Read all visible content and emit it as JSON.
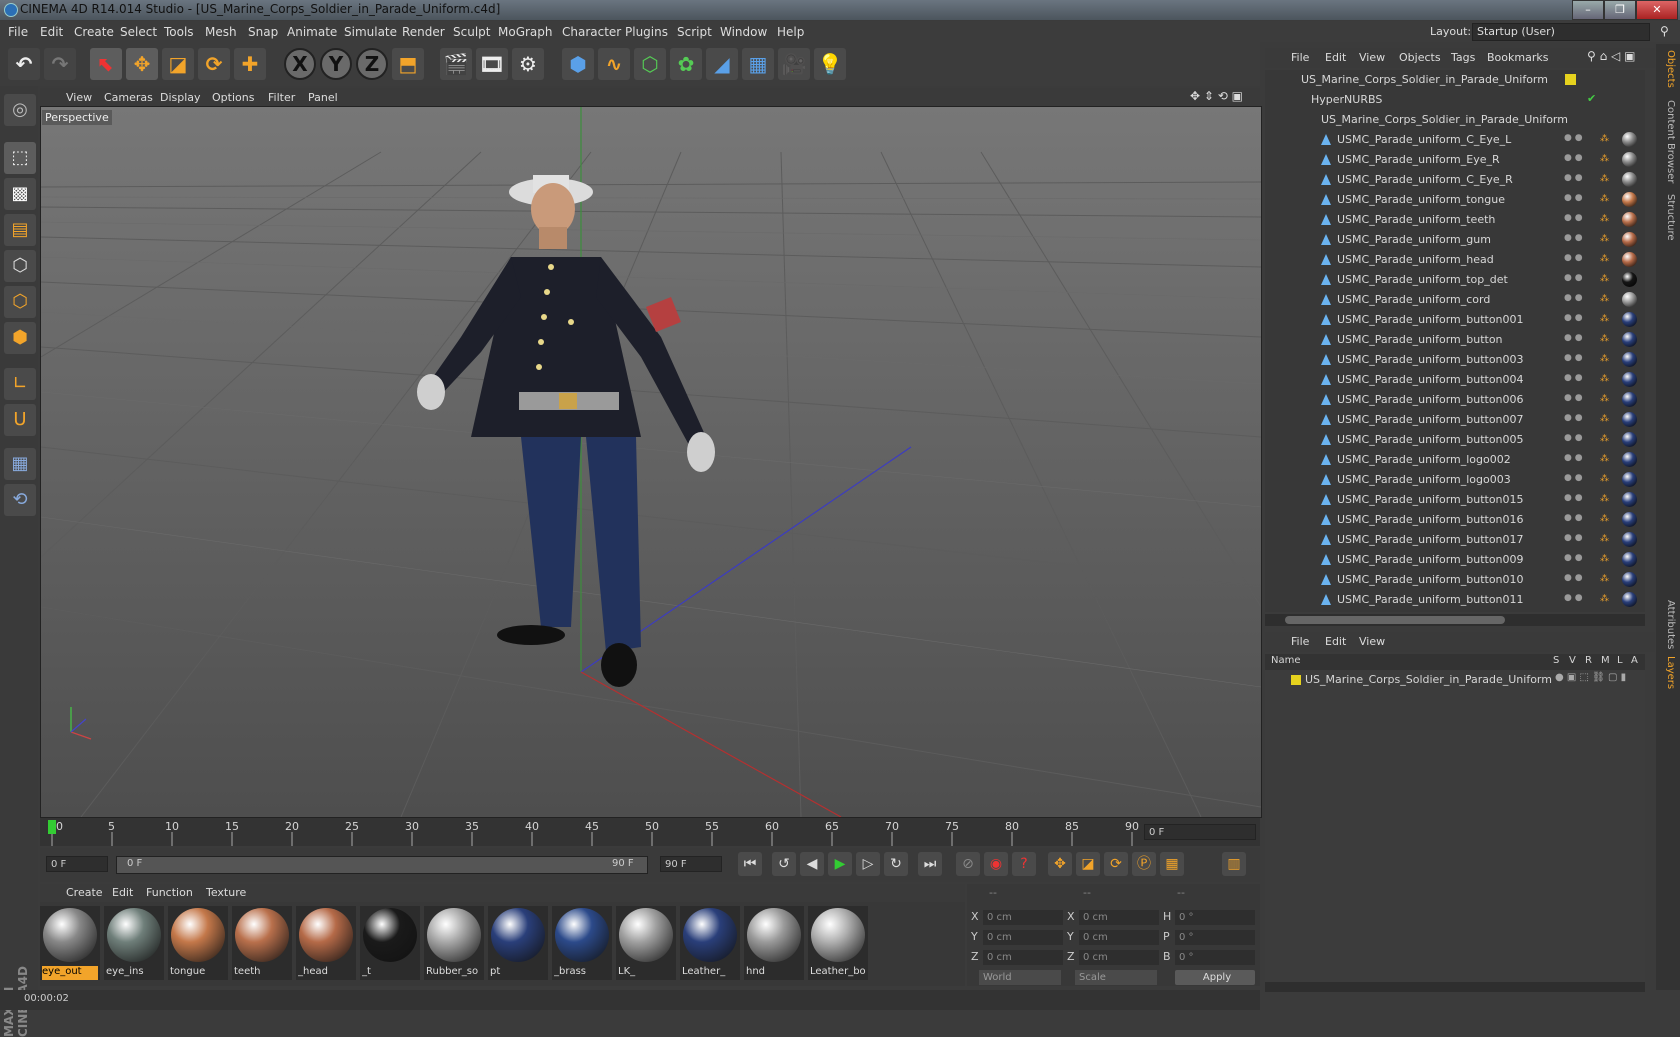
{
  "app": {
    "title": "CINEMA 4D R14.014 Studio - [US_Marine_Corps_Soldier_in_Parade_Uniform.c4d]",
    "layout_label": "Layout:",
    "layout_value": "Startup (User)"
  },
  "menu": [
    "File",
    "Edit",
    "Create",
    "Select",
    "Tools",
    "Mesh",
    "Snap",
    "Animate",
    "Simulate",
    "Render",
    "Sculpt",
    "MoGraph",
    "Character",
    "Plugins",
    "Script",
    "Window",
    "Help"
  ],
  "viewport": {
    "menu": [
      "View",
      "Cameras",
      "Display",
      "Options",
      "Filter",
      "Panel"
    ],
    "label": "Perspective"
  },
  "timeline": {
    "ticks": [
      "0",
      "5",
      "10",
      "15",
      "20",
      "25",
      "30",
      "35",
      "40",
      "45",
      "50",
      "55",
      "60",
      "65",
      "70",
      "75",
      "80",
      "85",
      "90"
    ],
    "current_frame": "0 F",
    "start": "0 F",
    "slider_start": "0 F",
    "slider_end": "90 F",
    "end": "90 F"
  },
  "materials": {
    "menu": [
      "Create",
      "Edit",
      "Function",
      "Texture"
    ],
    "items": [
      {
        "label": "eye_out",
        "color": "#888888",
        "active": true
      },
      {
        "label": "eye_ins",
        "color": "#6f7f7a",
        "active": false
      },
      {
        "label": "tongue",
        "color": "#c4784a",
        "active": false
      },
      {
        "label": "teeth",
        "color": "#b9704c",
        "active": false
      },
      {
        "label": "_head",
        "color": "#b56a48",
        "active": false
      },
      {
        "label": "_t",
        "color": "#1a1a1a",
        "active": false
      },
      {
        "label": "Rubber_so",
        "color": "#a8a8a8",
        "active": false
      },
      {
        "label": "pt",
        "color": "#2a3f7a",
        "active": false
      },
      {
        "label": "_brass",
        "color": "#2c4a8a",
        "active": false
      },
      {
        "label": "LK_",
        "color": "#a0a0a0",
        "active": false
      },
      {
        "label": "Leather_",
        "color": "#2a3f7a",
        "active": false
      },
      {
        "label": "hnd",
        "color": "#9a9a9a",
        "active": false
      },
      {
        "label": "Leather_bo",
        "color": "#b0b0b0",
        "active": false
      }
    ]
  },
  "coords": {
    "headers": [
      "--",
      "--",
      "--"
    ],
    "rows": [
      {
        "a": "X",
        "av": "0 cm",
        "b": "X",
        "bv": "0 cm",
        "c": "H",
        "cv": "0 °"
      },
      {
        "a": "Y",
        "av": "0 cm",
        "b": "Y",
        "bv": "0 cm",
        "c": "P",
        "cv": "0 °"
      },
      {
        "a": "Z",
        "av": "0 cm",
        "b": "Z",
        "bv": "0 cm",
        "c": "B",
        "cv": "0 °"
      }
    ],
    "world": "World",
    "scale": "Scale",
    "apply": "Apply"
  },
  "status": "00:00:02",
  "objects": {
    "menu": [
      "File",
      "Edit",
      "View",
      "Objects",
      "Tags",
      "Bookmarks"
    ],
    "root": "US_Marine_Corps_Soldier_in_Parade_Uniform",
    "hypernurbs": "HyperNURBS",
    "group": "US_Marine_Corps_Soldier_in_Parade_Uniform",
    "children": [
      {
        "name": "USMC_Parade_uniform_C_Eye_L",
        "mat": "#8a8a8a"
      },
      {
        "name": "USMC_Parade_uniform_Eye_R",
        "mat": "#8a8a8a"
      },
      {
        "name": "USMC_Parade_uniform_C_Eye_R",
        "mat": "#8a8a8a"
      },
      {
        "name": "USMC_Parade_uniform_tongue",
        "mat": "#c4784a"
      },
      {
        "name": "USMC_Parade_uniform_teeth",
        "mat": "#b9704c"
      },
      {
        "name": "USMC_Parade_uniform_gum",
        "mat": "#b56a48"
      },
      {
        "name": "USMC_Parade_uniform_head",
        "mat": "#b56a48"
      },
      {
        "name": "USMC_Parade_uniform_top_det",
        "mat": "#151515"
      },
      {
        "name": "USMC_Parade_uniform_cord",
        "mat": "#9a9a9a"
      },
      {
        "name": "USMC_Parade_uniform_button001",
        "mat": "#2a3f7a"
      },
      {
        "name": "USMC_Parade_uniform_button",
        "mat": "#2a3f7a"
      },
      {
        "name": "USMC_Parade_uniform_button003",
        "mat": "#2a3f7a"
      },
      {
        "name": "USMC_Parade_uniform_button004",
        "mat": "#2a3f7a"
      },
      {
        "name": "USMC_Parade_uniform_button006",
        "mat": "#2a3f7a"
      },
      {
        "name": "USMC_Parade_uniform_button007",
        "mat": "#2a3f7a"
      },
      {
        "name": "USMC_Parade_uniform_button005",
        "mat": "#2a3f7a"
      },
      {
        "name": "USMC_Parade_uniform_logo002",
        "mat": "#2a3f7a"
      },
      {
        "name": "USMC_Parade_uniform_logo003",
        "mat": "#2a3f7a"
      },
      {
        "name": "USMC_Parade_uniform_button015",
        "mat": "#2a3f7a"
      },
      {
        "name": "USMC_Parade_uniform_button016",
        "mat": "#2a3f7a"
      },
      {
        "name": "USMC_Parade_uniform_button017",
        "mat": "#2a3f7a"
      },
      {
        "name": "USMC_Parade_uniform_button009",
        "mat": "#2a3f7a"
      },
      {
        "name": "USMC_Parade_uniform_button010",
        "mat": "#2a3f7a"
      },
      {
        "name": "USMC_Parade_uniform_button011",
        "mat": "#2a3f7a"
      }
    ]
  },
  "layers": {
    "menu": [
      "File",
      "Edit",
      "View"
    ],
    "columns": [
      "Name",
      "S",
      "V",
      "R",
      "M",
      "L",
      "A"
    ],
    "item": "US_Marine_Corps_Soldier_in_Parade_Uniform"
  },
  "side_tabs": [
    "Objects",
    "Content Browser",
    "Structure",
    "Attributes",
    "Layers"
  ],
  "colors": {
    "accent": "#f2a42a",
    "panel": "#3a3a3a",
    "layer_yellow": "#e6d21e"
  }
}
